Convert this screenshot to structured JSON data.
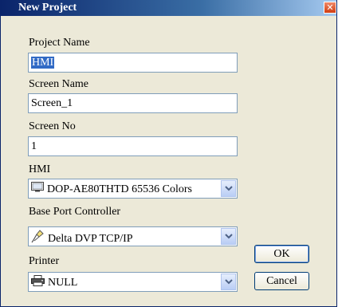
{
  "window": {
    "title": "New Project",
    "close_glyph": "✕"
  },
  "fields": {
    "project_name": {
      "label": "Project Name",
      "value": "HMI"
    },
    "screen_name": {
      "label": "Screen Name",
      "value": "Screen_1"
    },
    "screen_no": {
      "label": "Screen No",
      "value": "1"
    }
  },
  "selects": {
    "hmi": {
      "label": "HMI",
      "value": "DOP-AE80THTD 65536 Colors",
      "icon": "monitor-icon"
    },
    "base_port": {
      "label": "Base Port Controller",
      "value": "Delta DVP TCP/IP",
      "icon": "plug-icon"
    },
    "printer": {
      "label": "Printer",
      "value": "NULL",
      "icon": "printer-icon"
    }
  },
  "buttons": {
    "ok": "OK",
    "cancel": "Cancel"
  }
}
